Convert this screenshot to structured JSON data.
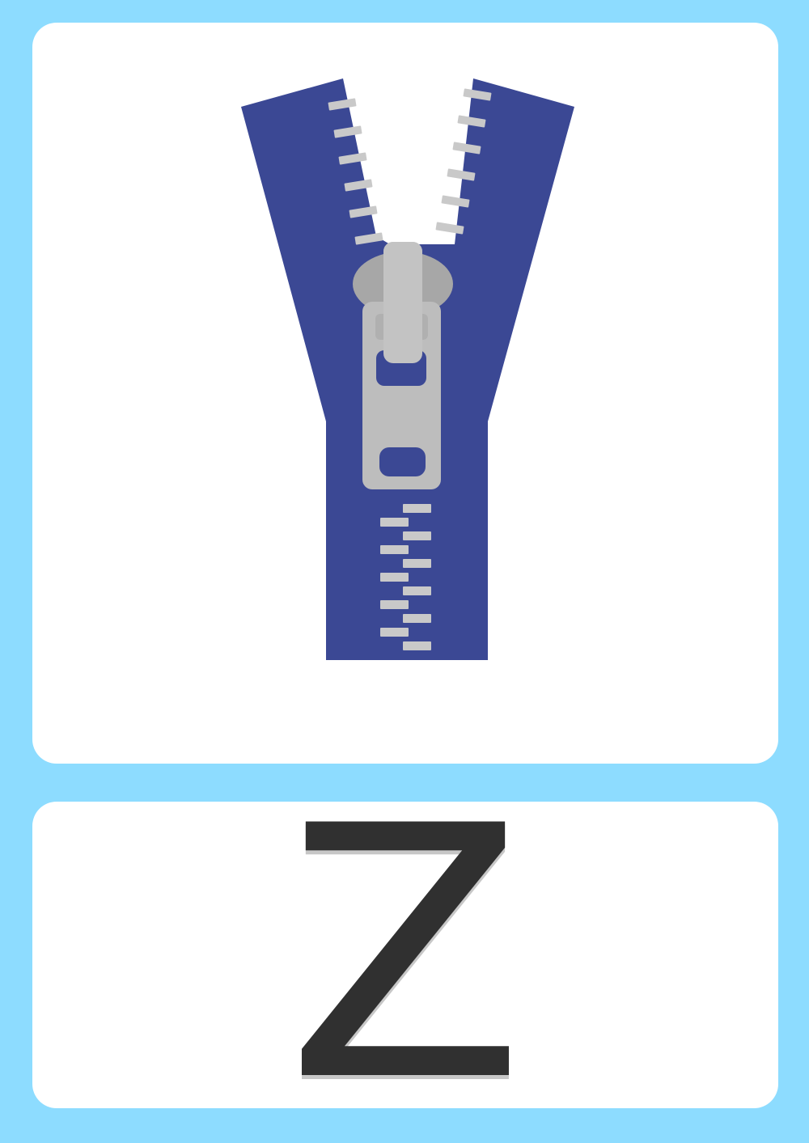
{
  "card": {
    "letter": "Z"
  },
  "illustration": {
    "icon": "zipper-icon",
    "colors": {
      "tape": "#3b4894",
      "teeth": "#c9c9c9",
      "slider": "#bdbdbd",
      "slider_shadow": "#a7a7a7"
    }
  },
  "colors": {
    "background": "#8ddcff",
    "card": "#ffffff",
    "letter": "#303030"
  }
}
